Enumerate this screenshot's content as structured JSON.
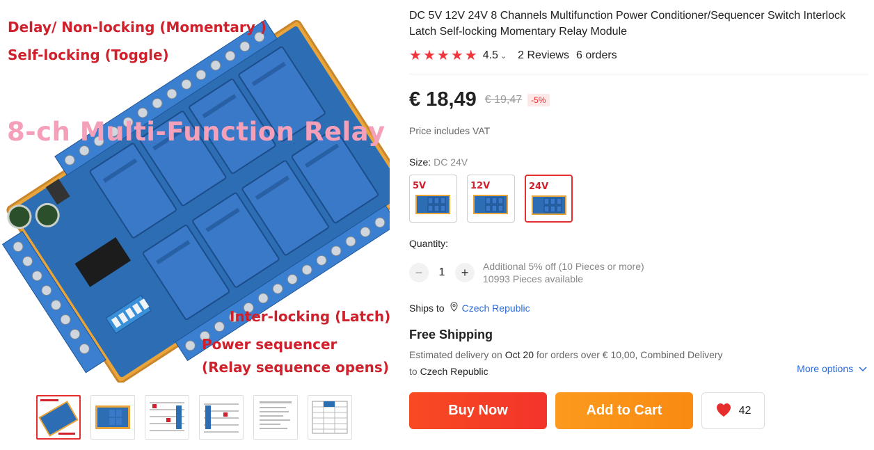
{
  "product": {
    "title": "DC 5V 12V 24V 8 Channels Multifunction Power Conditioner/Sequencer Switch Interlock Latch Self-locking Momentary Relay Module",
    "rating": "4.5",
    "reviews": "2 Reviews",
    "orders": "6 orders",
    "price": "€ 18,49",
    "old_price": "€ 19,47",
    "discount": "-5%",
    "vat_note": "Price includes VAT"
  },
  "image_overlay": {
    "line1": "Delay/ Non-locking (Momentary )",
    "line2": "Self-locking (Toggle)",
    "headline": "8-ch Multi-Function Relay",
    "line3": "Inter-locking (Latch)",
    "line4": "Power sequencer",
    "line5": "(Relay sequence opens)"
  },
  "thumbnails": [
    "thumb-1",
    "thumb-2",
    "thumb-3",
    "thumb-4",
    "thumb-5",
    "thumb-6"
  ],
  "size": {
    "label": "Size:",
    "selected": "DC 24V",
    "options": [
      {
        "label": "5V"
      },
      {
        "label": "12V"
      },
      {
        "label": "24V"
      }
    ]
  },
  "quantity": {
    "label": "Quantity:",
    "value": "1",
    "minus": "−",
    "plus": "+",
    "note1": "Additional 5% off (10 Pieces or more)",
    "note2": "10993 Pieces available"
  },
  "shipping": {
    "ships_to_label": "Ships to",
    "country": "Czech Republic",
    "free_shipping": "Free Shipping",
    "est_prefix": "Estimated delivery on",
    "est_date": "Oct 20",
    "est_suffix": "for orders over € 10,00, Combined Delivery",
    "to_label": "to",
    "to_country": "Czech Republic",
    "more_options": "More options"
  },
  "actions": {
    "buy_now": "Buy Now",
    "add_to_cart": "Add to Cart",
    "wishlist_count": "42"
  },
  "colors": {
    "accent_red": "#e62e2e",
    "buy_now": "#f84a22",
    "add_to_cart": "#fb9a1e",
    "link_blue": "#2a6bd6",
    "star": "#f1343c"
  }
}
